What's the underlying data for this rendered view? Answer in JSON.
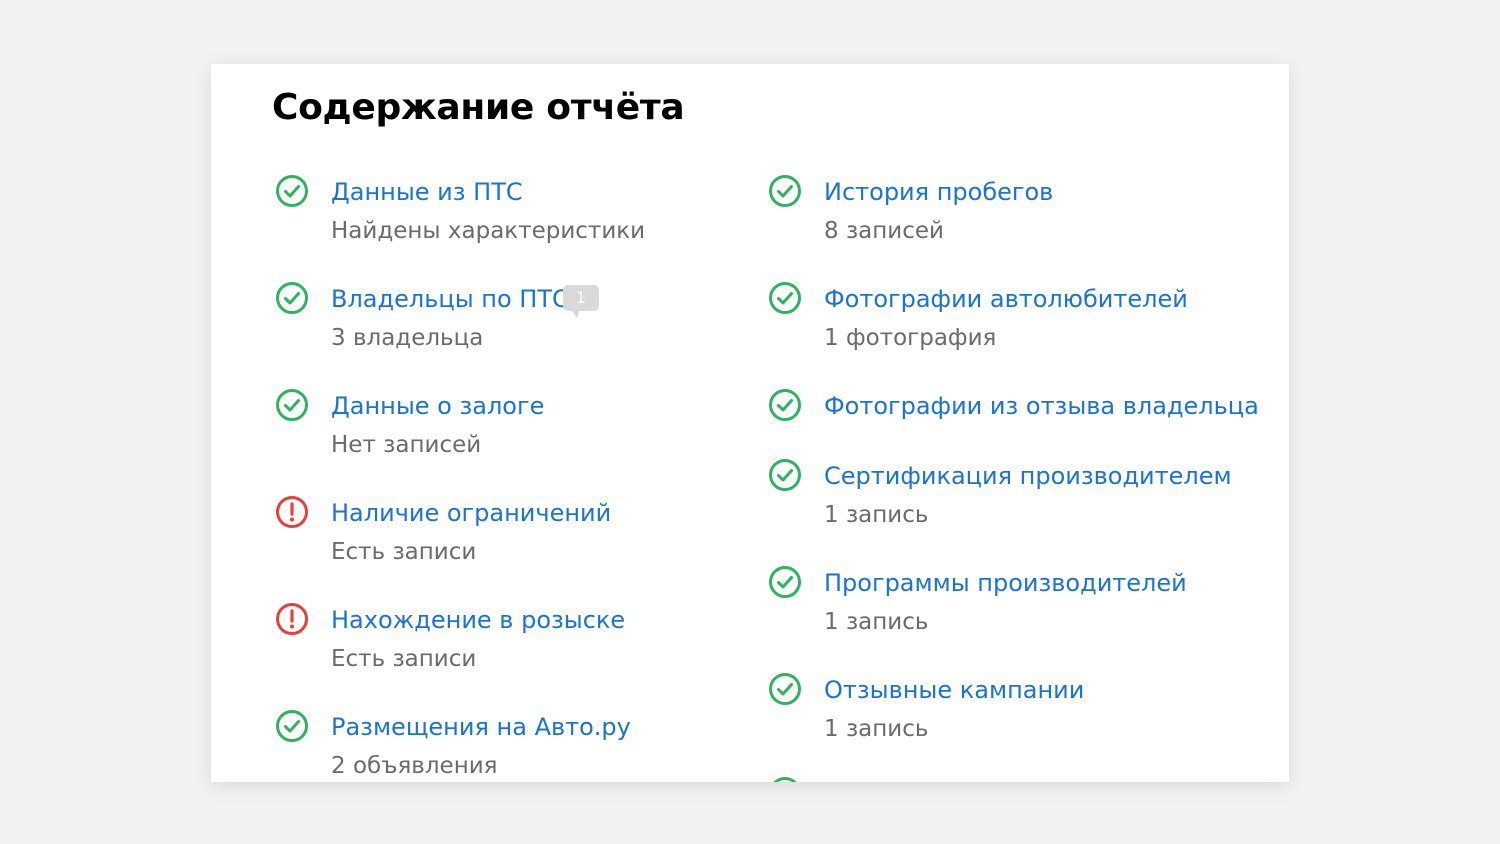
{
  "report": {
    "title": "Содержание отчёта",
    "status_colors": {
      "ok": "#2fb35f",
      "warning": "#e5413a"
    },
    "left_column": [
      {
        "label": "Данные из ПТС",
        "detail": "Найдены характеристики",
        "status": "ok",
        "icon": "check-circle-icon"
      },
      {
        "label": "Владельцы по ПТС",
        "detail": "3 владельца",
        "status": "ok",
        "icon": "check-circle-icon",
        "comment_count": "1"
      },
      {
        "label": "Данные о залоге",
        "detail": "Нет записей",
        "status": "ok",
        "icon": "check-circle-icon"
      },
      {
        "label": "Наличие ограничений",
        "detail": "Есть записи",
        "status": "warning",
        "icon": "exclamation-circle-icon"
      },
      {
        "label": "Нахождение в розыске",
        "detail": "Есть записи",
        "status": "warning",
        "icon": "exclamation-circle-icon"
      },
      {
        "label": "Размещения на Авто.ру",
        "detail": "2 объявления",
        "status": "ok",
        "icon": "check-circle-icon"
      }
    ],
    "right_column": [
      {
        "label": "История пробегов",
        "detail": "8 записей",
        "status": "ok",
        "icon": "check-circle-icon"
      },
      {
        "label": "Фотографии автолюбителей",
        "detail": "1 фотография",
        "status": "ok",
        "icon": "check-circle-icon"
      },
      {
        "label": "Фотографии из отзыва владельца",
        "detail": "",
        "status": "ok",
        "icon": "check-circle-icon"
      },
      {
        "label": "Сертификация производителем",
        "detail": "1 запись",
        "status": "ok",
        "icon": "check-circle-icon"
      },
      {
        "label": "Программы производителей",
        "detail": "1 запись",
        "status": "ok",
        "icon": "check-circle-icon"
      },
      {
        "label": "Отзывные кампании",
        "detail": "1 запись",
        "status": "ok",
        "icon": "check-circle-icon"
      },
      {
        "label": "",
        "detail": "",
        "status": "ok",
        "icon": "check-circle-icon"
      }
    ]
  }
}
